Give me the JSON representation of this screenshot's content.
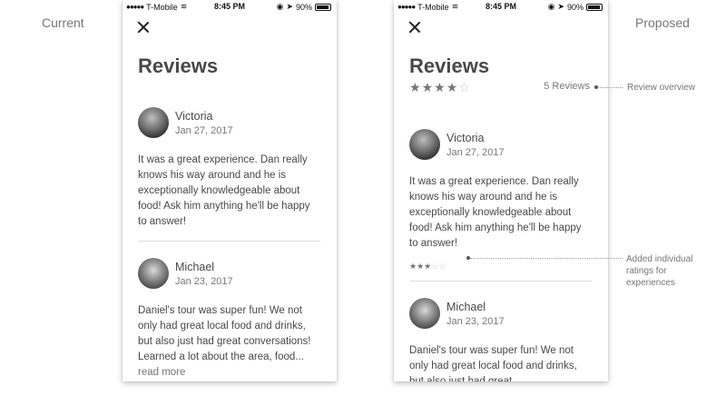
{
  "labels": {
    "current": "Current",
    "proposed": "Proposed"
  },
  "status_bar": {
    "carrier": "T-Mobile",
    "time": "8:45 PM",
    "battery": "90%",
    "signal_dots": "●●●●●"
  },
  "screen": {
    "title": "Reviews"
  },
  "overview": {
    "rating": 4,
    "max": 5,
    "count_text": "5 Reviews"
  },
  "reviews": [
    {
      "name": "Victoria",
      "date": "Jan 27, 2017",
      "text": "It was a great experience. Dan really knows his way around and he is exceptionally knowledgeable about food! Ask him anything he'll be happy to answer!",
      "rating": 3
    },
    {
      "name": "Michael",
      "date": "Jan 23, 2017",
      "text_current": "Daniel's tour was super fun! We not only had great local food and drinks, but also just had great conversations! Learned a lot about the area, food...",
      "read_more": "read more",
      "text_proposed": "Daniel's tour was super fun! We not only had great local food and drinks, but also just had great"
    }
  ],
  "annotations": {
    "overview": "Review overview",
    "individual": "Added individual ratings for experiences"
  },
  "icons": {
    "close": "close-icon",
    "wifi": "wifi-icon",
    "location": "location-arrow-icon",
    "battery": "battery-icon",
    "star": "star-icon"
  }
}
